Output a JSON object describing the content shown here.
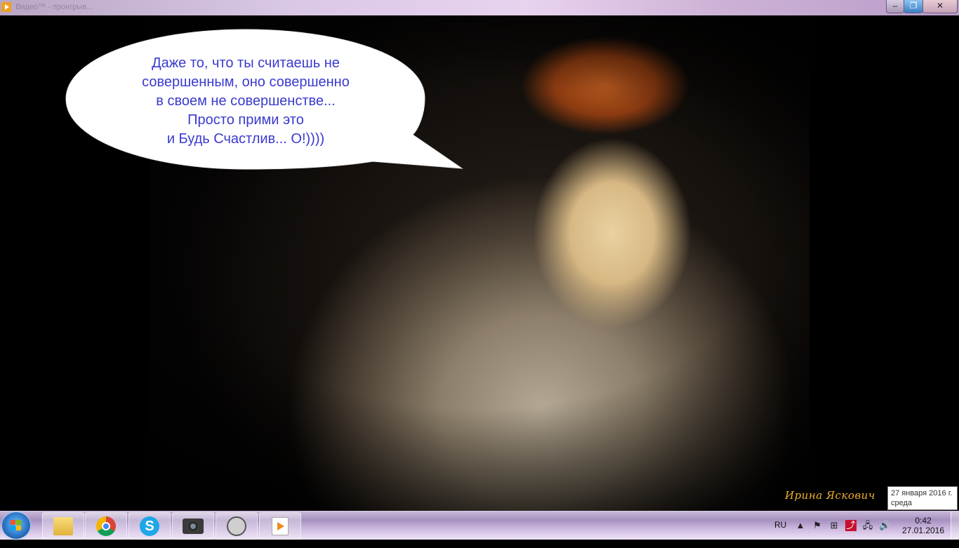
{
  "window": {
    "title": "Видео™ - проигрыв...",
    "controls": {
      "minimize": "–",
      "maximize": "❐",
      "close": "✕"
    }
  },
  "image": {
    "speech_bubble_lines": [
      "Даже то, что ты считаешь не",
      "совершенным, оно совершенно",
      "в своем не совершенстве...",
      "Просто прими это",
      "и Будь Счастлив... О!))))"
    ],
    "signature": "Ирина Яскович"
  },
  "taskbar": {
    "items": [
      "folder-icon",
      "chrome-icon",
      "skype-icon",
      "camera-icon",
      "movie-maker-icon",
      "media-player-icon"
    ],
    "tray": {
      "language": "RU",
      "icons": [
        "show-hidden-icons",
        "action-center-icon",
        "windows-icon",
        "pdf-icon",
        "network-icon",
        "volume-icon"
      ]
    },
    "clock": {
      "time": "0:42",
      "date": "27.01.2016"
    }
  },
  "tooltip": {
    "line1": "27 января 2016 г.",
    "line2": "среда"
  }
}
